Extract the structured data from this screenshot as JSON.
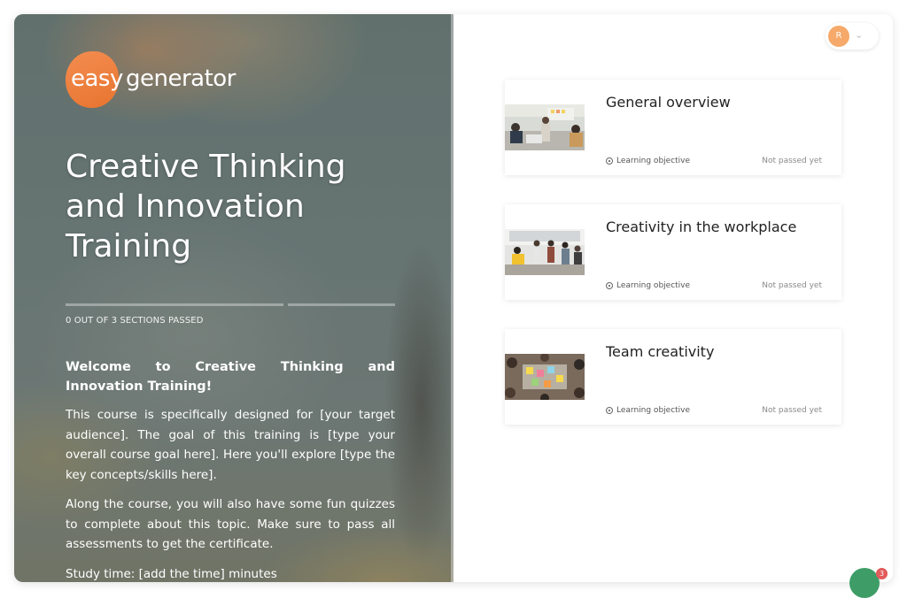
{
  "brand": {
    "logo_easy": "easy",
    "logo_generator": "generator",
    "logo_color": "#ee7c3a"
  },
  "course": {
    "title": "Creative Thinking and Innovation Training",
    "progress_label": "0 OUT OF 3 SECTIONS PASSED",
    "sections_passed": 0,
    "sections_total": 3,
    "welcome_heading": "Welcome to Creative Thinking and Innovation Training!",
    "paragraph_1": "This course is specifically designed for [your target audience]. The goal of this training is [type your overall course goal here]. Here you'll explore [type the key concepts/skills here].",
    "paragraph_2": "Along the course, you will also have some fun quizzes to complete about this topic. Make sure to pass all assessments to get the certificate.",
    "study_time": "Study time: [add the time] minutes"
  },
  "user": {
    "initial": "R",
    "avatar_color": "#f6a96a"
  },
  "sections": [
    {
      "title": "General overview",
      "objective_label": "Learning objective",
      "status": "Not passed yet",
      "icon": "target-icon"
    },
    {
      "title": "Creativity in the workplace",
      "objective_label": "Learning objective",
      "status": "Not passed yet",
      "icon": "target-icon"
    },
    {
      "title": "Team creativity",
      "objective_label": "Learning objective",
      "status": "Not passed yet",
      "icon": "target-icon"
    }
  ],
  "chat": {
    "badge_count": "3",
    "icon": "chat-icon",
    "color": "#3e9d67"
  }
}
